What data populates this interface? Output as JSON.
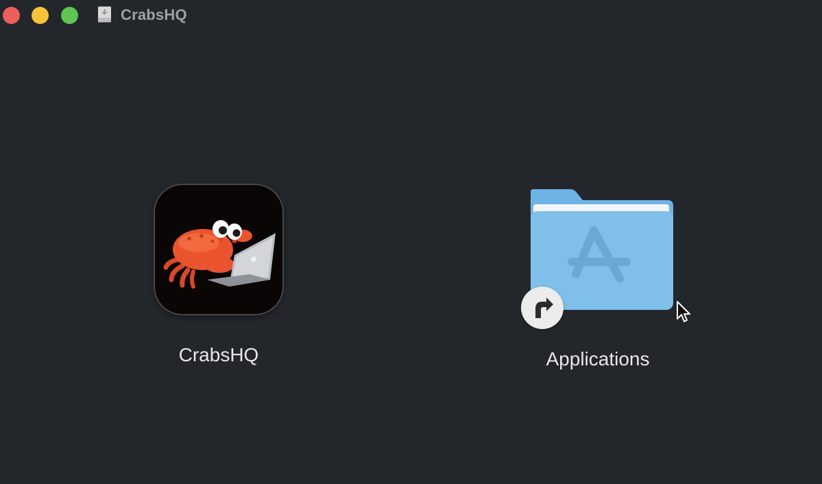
{
  "window": {
    "title": "CrabsHQ",
    "controls": [
      "close",
      "minimize",
      "zoom"
    ],
    "title_icon": "disk-image-icon"
  },
  "items": [
    {
      "label": "CrabsHQ",
      "icon": "crab-app-icon"
    },
    {
      "label": "Applications",
      "icon": "applications-folder-icon",
      "badge": "alias-arrow-icon"
    }
  ],
  "colors": {
    "background": "#23272c",
    "title_text": "#9ea1a5",
    "label_text": "#e7e7e7",
    "close": "#ec5f5b",
    "minimize": "#f4c33a",
    "zoom": "#5ec553",
    "folder": "#7fbfe9",
    "crab": "#e9542e"
  }
}
